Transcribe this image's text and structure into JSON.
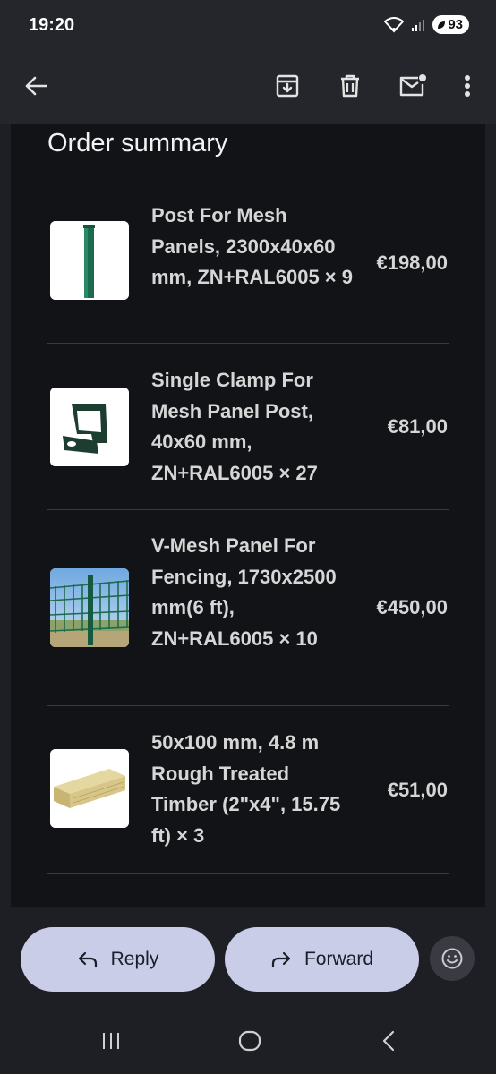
{
  "status": {
    "time": "19:20",
    "battery": "93"
  },
  "toolbar": {
    "back": "Back",
    "archive": "Archive",
    "delete": "Delete",
    "mark_unread": "Mark unread",
    "more": "More options"
  },
  "summary_title": "Order summary",
  "items": [
    {
      "desc": "Post For Mesh Panels, 2300x40x60 mm, ZN+RAL6005 × 9",
      "price": "€198,00"
    },
    {
      "desc": "Single Clamp For Mesh Panel Post, 40x60 mm, ZN+RAL6005 × 27",
      "price": "€81,00"
    },
    {
      "desc": "V-Mesh Panel For Fencing, 1730x2500 mm(6 ft), ZN+RAL6005 × 10",
      "price": "€450,00"
    },
    {
      "desc": "50x100 mm, 4.8 m Rough Treated Timber (2\"x4\", 15.75 ft) × 3",
      "price": "€51,00"
    }
  ],
  "actions": {
    "reply": "Reply",
    "forward": "Forward"
  },
  "colors": {
    "background": "#1e1f24",
    "card": "#121316",
    "pill": "#c9cde8",
    "accent_green": "#1d6b4e"
  }
}
